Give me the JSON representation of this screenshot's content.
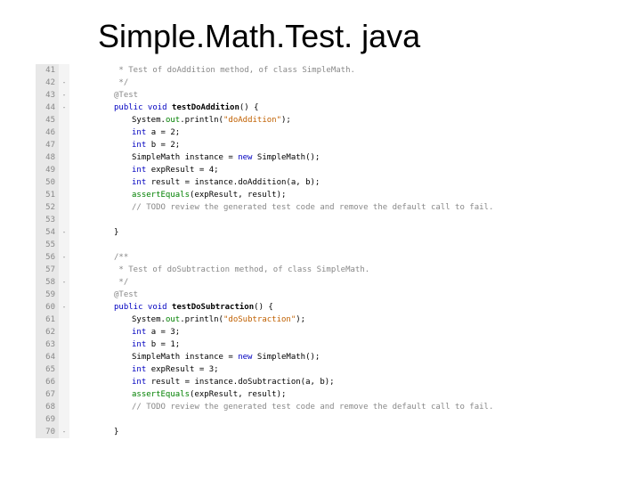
{
  "title": "Simple.Math.Test. java",
  "lines": [
    {
      "n": 41,
      "fold": "",
      "indent": "i2",
      "tokens": [
        {
          "c": "cm",
          "t": " * Test of doAddition method, of class SimpleMath."
        }
      ]
    },
    {
      "n": 42,
      "fold": "-",
      "indent": "i2",
      "tokens": [
        {
          "c": "cm",
          "t": " */"
        }
      ]
    },
    {
      "n": 43,
      "fold": "-",
      "indent": "i2",
      "tokens": [
        {
          "c": "ann",
          "t": "@Test"
        }
      ]
    },
    {
      "n": 44,
      "fold": "-",
      "indent": "i2",
      "tokens": [
        {
          "c": "kw",
          "t": "public void "
        },
        {
          "c": "mth",
          "t": "testDoAddition"
        },
        {
          "c": "plain",
          "t": "() {"
        }
      ]
    },
    {
      "n": 45,
      "fold": "",
      "indent": "i3",
      "tokens": [
        {
          "c": "plain",
          "t": "System."
        },
        {
          "c": "fld",
          "t": "out"
        },
        {
          "c": "plain",
          "t": ".println("
        },
        {
          "c": "str",
          "t": "\"doAddition\""
        },
        {
          "c": "plain",
          "t": ");"
        }
      ]
    },
    {
      "n": 46,
      "fold": "",
      "indent": "i3",
      "tokens": [
        {
          "c": "kw",
          "t": "int "
        },
        {
          "c": "plain",
          "t": "a = 2;"
        }
      ]
    },
    {
      "n": 47,
      "fold": "",
      "indent": "i3",
      "tokens": [
        {
          "c": "kw",
          "t": "int "
        },
        {
          "c": "plain",
          "t": "b = 2;"
        }
      ]
    },
    {
      "n": 48,
      "fold": "",
      "indent": "i3",
      "tokens": [
        {
          "c": "plain",
          "t": "SimpleMath instance = "
        },
        {
          "c": "kw",
          "t": "new "
        },
        {
          "c": "plain",
          "t": "SimpleMath();"
        }
      ]
    },
    {
      "n": 49,
      "fold": "",
      "indent": "i3",
      "tokens": [
        {
          "c": "kw",
          "t": "int "
        },
        {
          "c": "plain",
          "t": "expResult = 4;"
        }
      ]
    },
    {
      "n": 50,
      "fold": "",
      "indent": "i3",
      "tokens": [
        {
          "c": "kw",
          "t": "int "
        },
        {
          "c": "plain",
          "t": "result = instance.doAddition(a, b);"
        }
      ]
    },
    {
      "n": 51,
      "fold": "",
      "indent": "i3",
      "tokens": [
        {
          "c": "fld",
          "t": "assertEquals"
        },
        {
          "c": "plain",
          "t": "(expResult, result);"
        }
      ]
    },
    {
      "n": 52,
      "fold": "",
      "indent": "i3",
      "tokens": [
        {
          "c": "cm",
          "t": "// TODO review the generated test code and remove the default call to fail."
        }
      ]
    },
    {
      "n": 53,
      "fold": "",
      "indent": "i3",
      "tokens": []
    },
    {
      "n": 54,
      "fold": "-",
      "indent": "i2",
      "tokens": [
        {
          "c": "plain",
          "t": "}"
        }
      ]
    },
    {
      "n": 55,
      "fold": "",
      "indent": "i2",
      "tokens": []
    },
    {
      "n": 56,
      "fold": "-",
      "indent": "i2",
      "tokens": [
        {
          "c": "cm",
          "t": "/**"
        }
      ]
    },
    {
      "n": 57,
      "fold": "",
      "indent": "i2",
      "tokens": [
        {
          "c": "cm",
          "t": " * Test of doSubtraction method, of class SimpleMath."
        }
      ]
    },
    {
      "n": 58,
      "fold": "-",
      "indent": "i2",
      "tokens": [
        {
          "c": "cm",
          "t": " */"
        }
      ]
    },
    {
      "n": 59,
      "fold": "",
      "indent": "i2",
      "tokens": [
        {
          "c": "ann",
          "t": "@Test"
        }
      ]
    },
    {
      "n": 60,
      "fold": "-",
      "indent": "i2",
      "tokens": [
        {
          "c": "kw",
          "t": "public void "
        },
        {
          "c": "mth",
          "t": "testDoSubtraction"
        },
        {
          "c": "plain",
          "t": "() {"
        }
      ]
    },
    {
      "n": 61,
      "fold": "",
      "indent": "i3",
      "tokens": [
        {
          "c": "plain",
          "t": "System."
        },
        {
          "c": "fld",
          "t": "out"
        },
        {
          "c": "plain",
          "t": ".println("
        },
        {
          "c": "str",
          "t": "\"doSubtraction\""
        },
        {
          "c": "plain",
          "t": ");"
        }
      ]
    },
    {
      "n": 62,
      "fold": "",
      "indent": "i3",
      "tokens": [
        {
          "c": "kw",
          "t": "int "
        },
        {
          "c": "plain",
          "t": "a = 3;"
        }
      ]
    },
    {
      "n": 63,
      "fold": "",
      "indent": "i3",
      "tokens": [
        {
          "c": "kw",
          "t": "int "
        },
        {
          "c": "plain",
          "t": "b = 1;"
        }
      ]
    },
    {
      "n": 64,
      "fold": "",
      "indent": "i3",
      "tokens": [
        {
          "c": "plain",
          "t": "SimpleMath instance = "
        },
        {
          "c": "kw",
          "t": "new "
        },
        {
          "c": "plain",
          "t": "SimpleMath();"
        }
      ]
    },
    {
      "n": 65,
      "fold": "",
      "indent": "i3",
      "tokens": [
        {
          "c": "kw",
          "t": "int "
        },
        {
          "c": "plain",
          "t": "expResult = 3;"
        }
      ]
    },
    {
      "n": 66,
      "fold": "",
      "indent": "i3",
      "tokens": [
        {
          "c": "kw",
          "t": "int "
        },
        {
          "c": "plain",
          "t": "result = instance.doSubtraction(a, b);"
        }
      ]
    },
    {
      "n": 67,
      "fold": "",
      "indent": "i3",
      "tokens": [
        {
          "c": "fld",
          "t": "assertEquals"
        },
        {
          "c": "plain",
          "t": "(expResult, result);"
        }
      ]
    },
    {
      "n": 68,
      "fold": "",
      "indent": "i3",
      "tokens": [
        {
          "c": "cm",
          "t": "// TODO review the generated test code and remove the default call to fail."
        }
      ]
    },
    {
      "n": 69,
      "fold": "",
      "indent": "i3",
      "tokens": []
    },
    {
      "n": 70,
      "fold": "-",
      "indent": "i2",
      "tokens": [
        {
          "c": "plain",
          "t": "}"
        }
      ]
    }
  ]
}
